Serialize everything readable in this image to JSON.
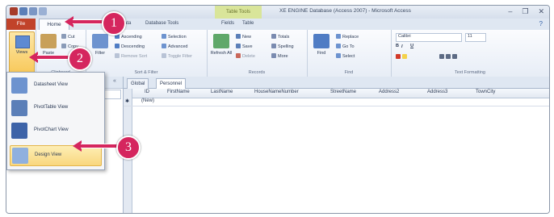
{
  "window": {
    "title": "XE ENGINE Database (Access 2007) - Microsoft Access",
    "context_tab": "Table Tools",
    "min": "–",
    "max": "❐",
    "close": "✕"
  },
  "ribbon_tabs": {
    "file": "File",
    "home": "Home",
    "tabs": [
      "Create",
      "External Data",
      "Database Tools",
      "Fields",
      "Table"
    ],
    "help": "?"
  },
  "ribbon": {
    "views_label": "Views",
    "clipboard": {
      "paste": "Paste",
      "cut": "Cut",
      "copy": "Copy",
      "format_painter": "Format Painter",
      "group": "Clipboard"
    },
    "sort_filter": {
      "filter": "Filter",
      "ascending": "Ascending",
      "descending": "Descending",
      "remove_sort": "Remove Sort",
      "selection": "Selection",
      "advanced": "Advanced",
      "toggle_filter": "Toggle Filter",
      "group": "Sort & Filter"
    },
    "records": {
      "refresh": "Refresh All",
      "new": "New",
      "save": "Save",
      "delete": "Delete",
      "totals": "Totals",
      "spelling": "Spelling",
      "more": "More",
      "group": "Records"
    },
    "find": {
      "find": "Find",
      "replace": "Replace",
      "goto": "Go To",
      "select": "Select",
      "group": "Find"
    },
    "text_formatting": {
      "font": "Calibri",
      "size": "11",
      "group": "Text Formatting"
    }
  },
  "views_menu": {
    "items": [
      {
        "label": "Datasheet View"
      },
      {
        "label": "PivotTable View"
      },
      {
        "label": "PivotChart View"
      },
      {
        "label": "Design View"
      }
    ]
  },
  "nav_pane": {
    "toggle": "«"
  },
  "document": {
    "tabs": [
      "Global",
      "Personnel"
    ],
    "columns": [
      "ID",
      "FirstName",
      "LastName",
      "HouseNameNumber",
      "StreetName",
      "Address2",
      "Address3",
      "TownCity"
    ],
    "new_row_marker": "✱",
    "new_row_label": "(New)"
  },
  "callouts": [
    {
      "number": "1"
    },
    {
      "number": "2"
    },
    {
      "number": "3"
    }
  ],
  "colors": {
    "accent": "#d5265e",
    "file_tab": "#c1432a",
    "highlight": "#f9d77e"
  }
}
